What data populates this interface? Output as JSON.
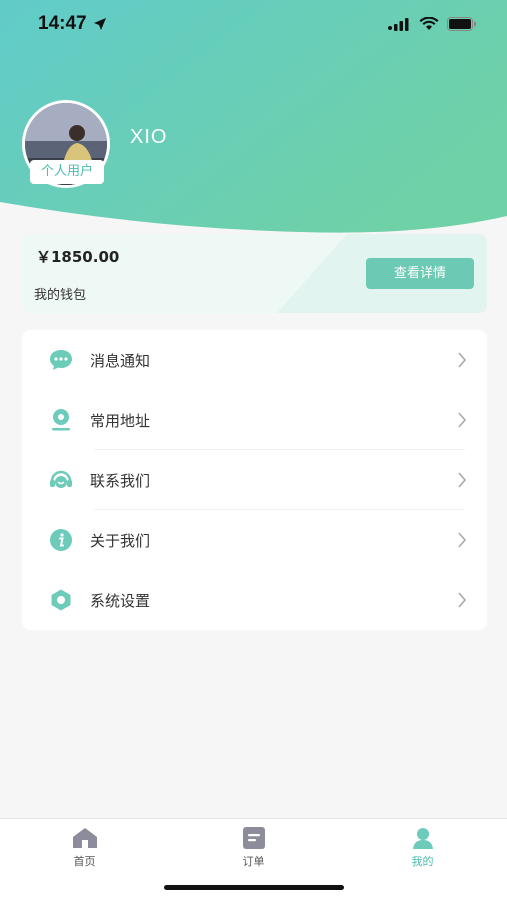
{
  "status_bar": {
    "time": "14:47"
  },
  "profile": {
    "username": "XIO",
    "user_type": "个人用户"
  },
  "wallet": {
    "balance": "￥1850.00",
    "label": "我的钱包",
    "button": "查看详情"
  },
  "menu": [
    {
      "label": "消息通知",
      "icon": "message-icon"
    },
    {
      "label": "常用地址",
      "icon": "location-icon"
    },
    {
      "label": "联系我们",
      "icon": "headset-icon"
    },
    {
      "label": "关于我们",
      "icon": "info-icon"
    },
    {
      "label": "系统设置",
      "icon": "settings-icon"
    }
  ],
  "tabs": [
    {
      "label": "首页",
      "icon": "home-icon",
      "active": false
    },
    {
      "label": "订单",
      "icon": "order-icon",
      "active": false
    },
    {
      "label": "我的",
      "icon": "profile-icon",
      "active": true
    }
  ],
  "colors": {
    "accent": "#4cbcae",
    "header_start": "#5cc9c2",
    "header_end": "#6cd0a8"
  }
}
